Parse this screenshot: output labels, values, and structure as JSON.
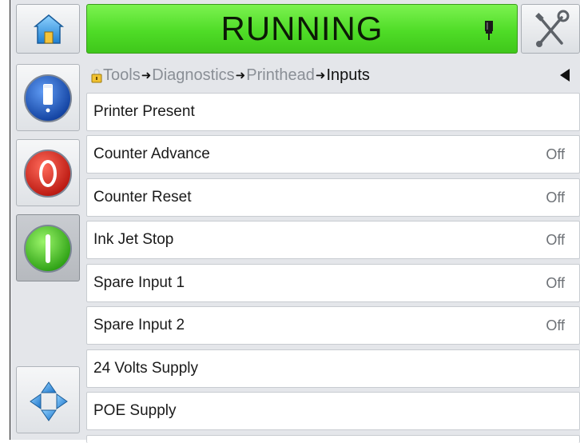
{
  "header": {
    "status_text": "RUNNING",
    "status_color": "#4fdc27",
    "home_icon": "home-icon",
    "tools_icon": "tools-icon",
    "beacon_icon": "status-beacon-icon"
  },
  "sidebar": {
    "buttons": [
      {
        "name": "info-button",
        "icon": "info-icon"
      },
      {
        "name": "stop-button",
        "icon": "stop-icon"
      },
      {
        "name": "start-button",
        "icon": "start-icon",
        "pressed": true
      },
      {
        "name": "navigate-button",
        "icon": "navigate-arrows-icon"
      }
    ]
  },
  "breadcrumb": {
    "items": [
      "Tools",
      "Diagnostics",
      "Printhead",
      "Inputs"
    ]
  },
  "rows": [
    {
      "label": "Printer Present",
      "value": ""
    },
    {
      "label": "Counter Advance",
      "value": "Off"
    },
    {
      "label": "Counter Reset",
      "value": "Off"
    },
    {
      "label": "Ink Jet Stop",
      "value": "Off"
    },
    {
      "label": "Spare Input 1",
      "value": "Off"
    },
    {
      "label": "Spare Input 2",
      "value": "Off"
    },
    {
      "label": "24 Volts Supply",
      "value": ""
    },
    {
      "label": "POE Supply",
      "value": ""
    }
  ]
}
